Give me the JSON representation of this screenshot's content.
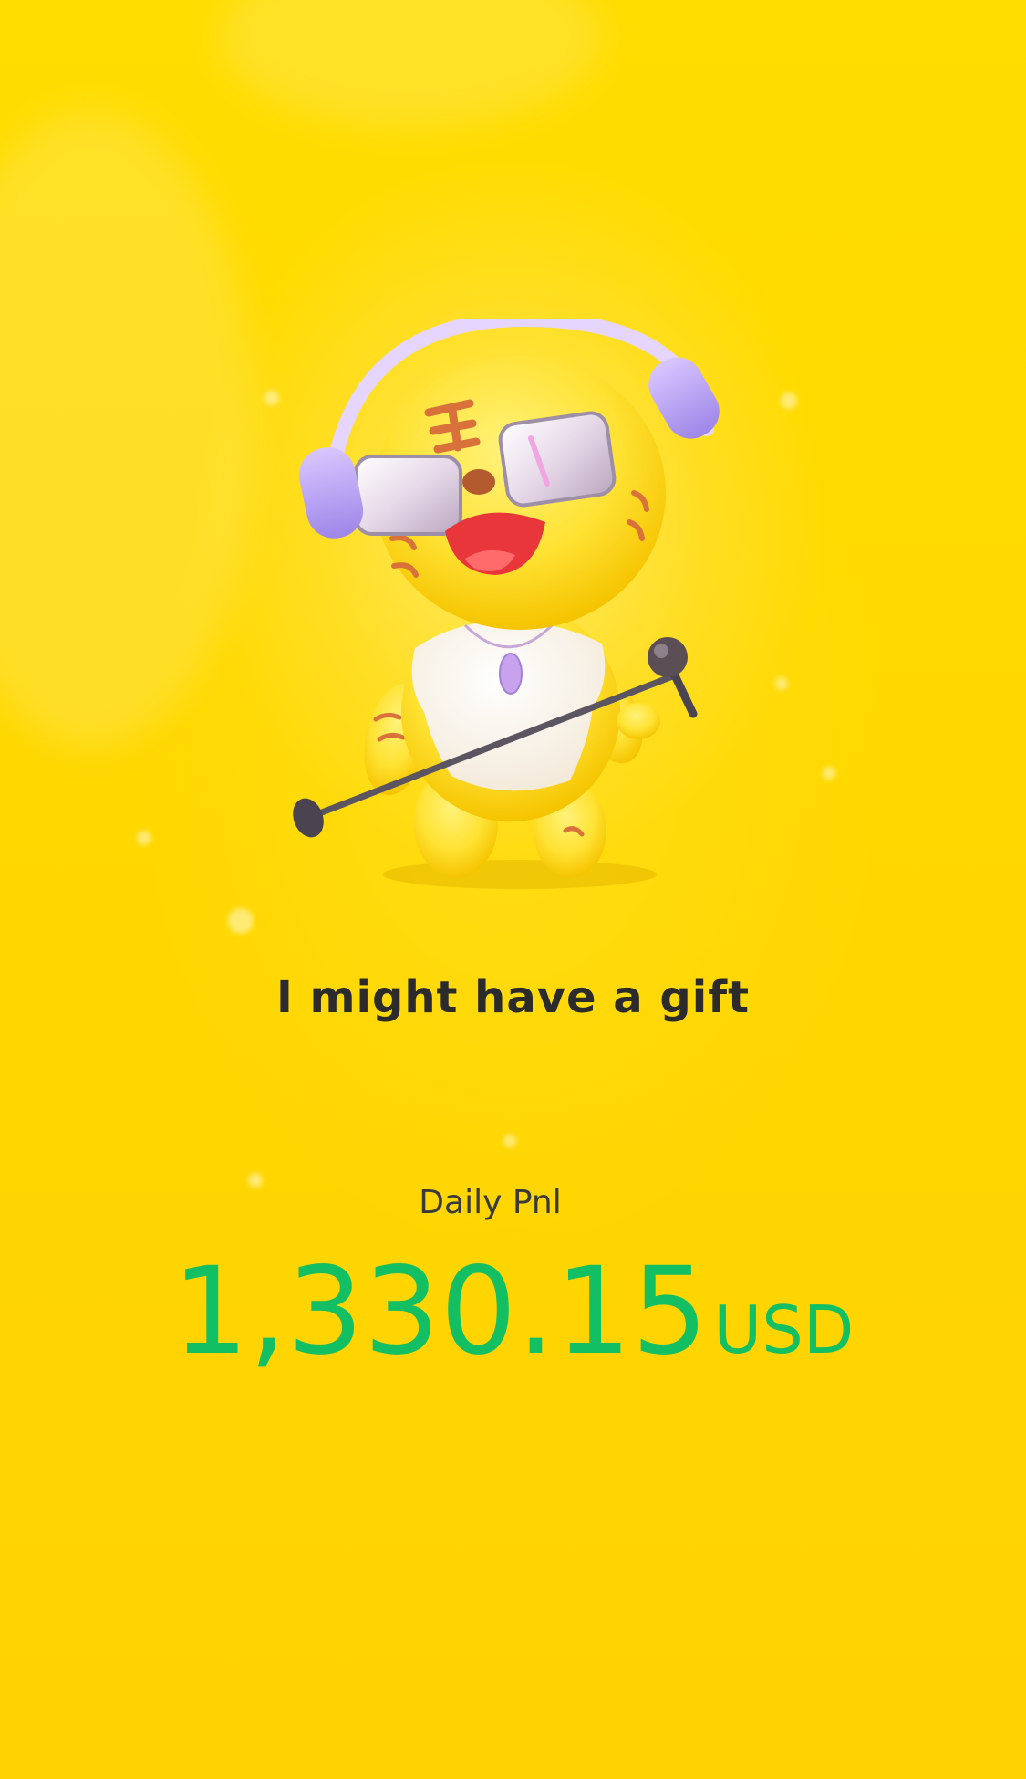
{
  "tagline": "I might have a gift",
  "pnl": {
    "label": "Daily Pnl",
    "value": "1,330.15",
    "currency": "USD"
  },
  "colors": {
    "background": "#FFD600",
    "pnl_value": "#12BF62",
    "text_dark": "#2B2B2B"
  },
  "illustration": {
    "name": "tiger-mascot-singer",
    "accessories": [
      "headphones",
      "sunglasses",
      "microphone-stand",
      "pendant-necklace",
      "white-shirt"
    ]
  }
}
